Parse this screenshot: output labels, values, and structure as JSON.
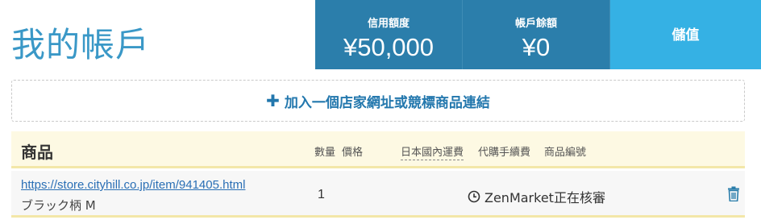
{
  "header": {
    "title": "我的帳戶"
  },
  "stats": {
    "credit_label": "信用額度",
    "credit_value": "¥50,000",
    "balance_label": "帳戶餘額",
    "balance_value": "¥0",
    "topup_label": "儲值"
  },
  "add_link": {
    "label": "加入一個店家網址或競標商品連結",
    "icon": "plus-icon"
  },
  "table": {
    "title": "商品",
    "columns": [
      "數量",
      "價格",
      "日本國內運費",
      "代購手續費",
      "商品編號"
    ],
    "rows": [
      {
        "url": "https://store.cityhill.co.jp/item/941405.html",
        "variant": "ブラック柄 M",
        "quantity": "1",
        "status": "ZenMarket正在核審",
        "status_icon": "clock-icon",
        "action_icon": "trash-icon"
      }
    ]
  },
  "colors": {
    "accent_dark": "#2b7eab",
    "accent_light": "#35b1e4",
    "title": "#3a98c7",
    "table_header_bg": "#fdf9e3"
  }
}
